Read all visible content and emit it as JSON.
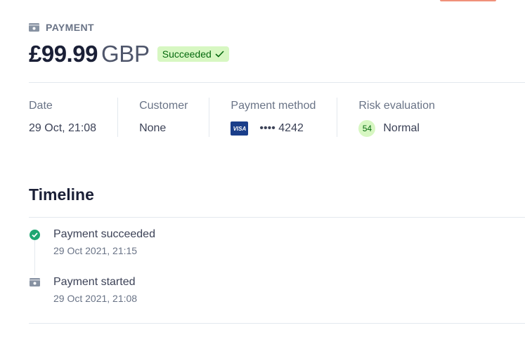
{
  "header": {
    "label": "PAYMENT",
    "amount": "£99.99",
    "currency": "GBP",
    "status": "Succeeded",
    "status_color": "#d7f7c2"
  },
  "summary": {
    "date": {
      "label": "Date",
      "value": "29 Oct, 21:08"
    },
    "customer": {
      "label": "Customer",
      "value": "None"
    },
    "payment_method": {
      "label": "Payment method",
      "card_brand": "VISA",
      "value": "•••• 4242"
    },
    "risk": {
      "label": "Risk evaluation",
      "score": "54",
      "value": "Normal"
    }
  },
  "timeline": {
    "title": "Timeline",
    "items": [
      {
        "title": "Payment succeeded",
        "time": "29 Oct 2021, 21:15",
        "icon": "check-circle-icon"
      },
      {
        "title": "Payment started",
        "time": "29 Oct 2021, 21:08",
        "icon": "payment-icon"
      }
    ]
  },
  "colors": {
    "success": "#05690d",
    "success_bg": "#d7f7c2",
    "accent": "#f0917a",
    "visa": "#1a3e8a"
  }
}
